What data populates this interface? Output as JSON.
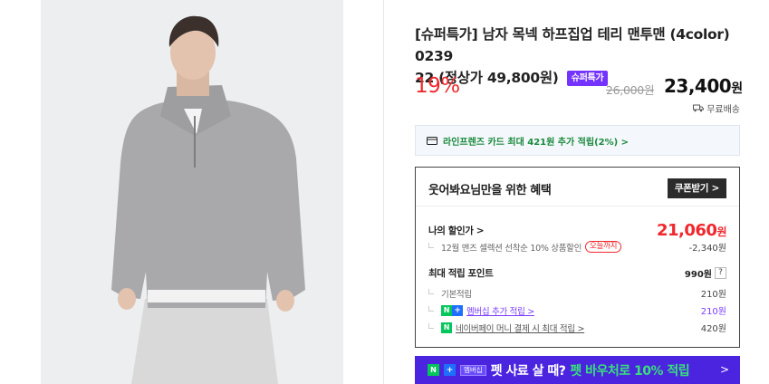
{
  "product": {
    "title_main": "[슈퍼특가] 남자 목넥 하프집업 테리 맨투맨 (4color) 0239",
    "title_rest": "22 (정상가 49,800원)",
    "badge": "슈퍼특가",
    "discount": "19%",
    "original_price": "26,000원",
    "sale_price": "23,400",
    "sale_unit": "원",
    "shipping": "무료배송"
  },
  "card_promo": {
    "text": "라인프렌즈 카드 최대 421원 추가 적립(2%) >"
  },
  "benefit": {
    "title": "웃어봐요님만을 위한 혜택",
    "coupon_button": "쿠폰받기 >",
    "my_price_label": "나의 할인가 >",
    "my_price": "21,060",
    "my_price_unit": "원",
    "coupon_desc": "12월 맨즈 셀렉션 선착순 10% 상품할인",
    "today_pill": "오늘까지",
    "coupon_amount": "-2,340원",
    "points_label": "최대 적립 포인트",
    "points_value": "990원",
    "help": "?",
    "basic_label": "기본적립",
    "basic_value": "210원",
    "membership_label": "멤버십 추가 적립 >",
    "membership_value": "210원",
    "npay_label": "네이버페이 머니 결제 시 최대 적립 >",
    "npay_value": "420원"
  },
  "banner": {
    "n": "N",
    "plus": "+",
    "membership": "멤버십",
    "text": "펫 사료 살 때?",
    "highlight": "펫 바우처로 10% 적립",
    "arrow": ">"
  },
  "colors": {
    "accent_red": "#f0282d",
    "badge_purple": "#7433ff",
    "naver_green": "#03c75a",
    "banner_bg": "#4b24e0"
  }
}
